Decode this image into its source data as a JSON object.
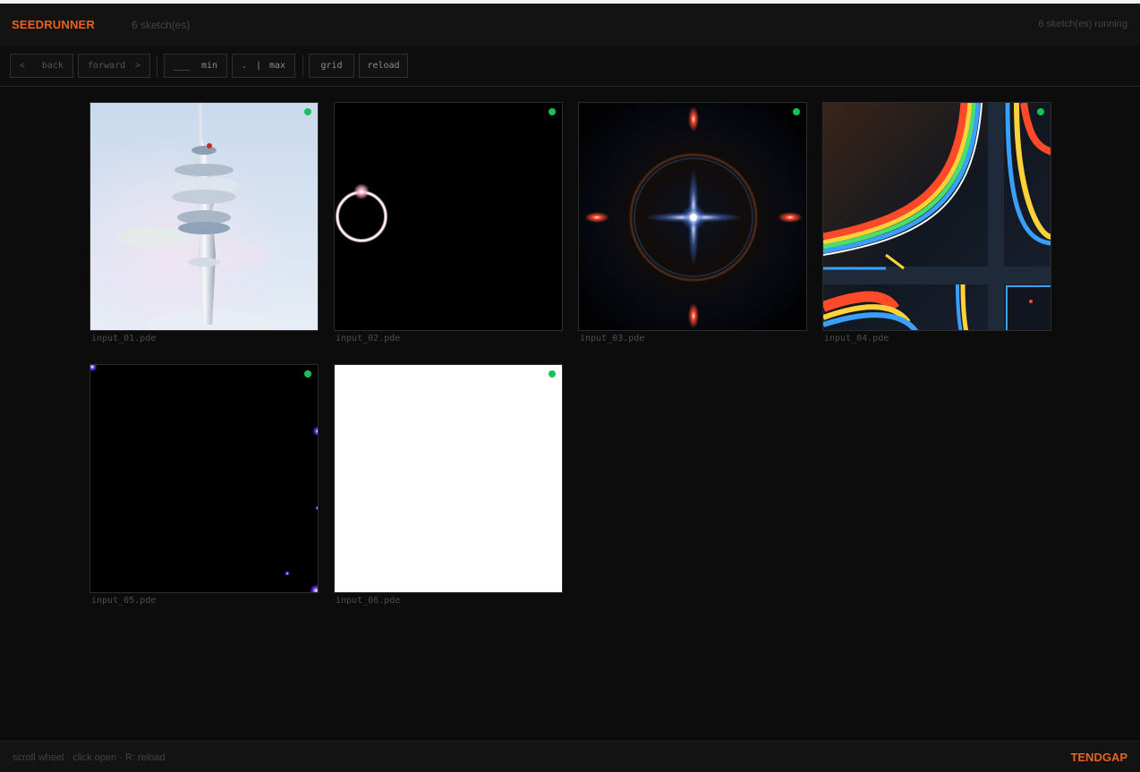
{
  "header": {
    "brand": "SEEDRUNNER",
    "count": "6 sketch(es)",
    "running": "6 sketch(es) running"
  },
  "toolbar": {
    "back_arrow": "<",
    "back_label": "back",
    "forward_label": "forward",
    "forward_arrow": ">",
    "min_blank": "___",
    "min_label": "min",
    "max_dot": ".",
    "max_bar": "|",
    "max_label": "max",
    "grid_label": "grid",
    "reload_label": "reload"
  },
  "sketches": [
    {
      "filename": "input_01.pde",
      "status": "running"
    },
    {
      "filename": "input_02.pde",
      "status": "running"
    },
    {
      "filename": "input_03.pde",
      "status": "running"
    },
    {
      "filename": "input_04.pde",
      "status": "running"
    },
    {
      "filename": "input_05.pde",
      "status": "running"
    },
    {
      "filename": "input_06.pde",
      "status": "running"
    }
  ],
  "footer": {
    "hint": "scroll wheel · click open · R: reload",
    "credit": "TENDGAP"
  },
  "colors": {
    "accent": "#e8631c",
    "status_running": "#18c25a",
    "background": "#0c0c0c"
  },
  "icons": [
    "status-dot-icon"
  ]
}
